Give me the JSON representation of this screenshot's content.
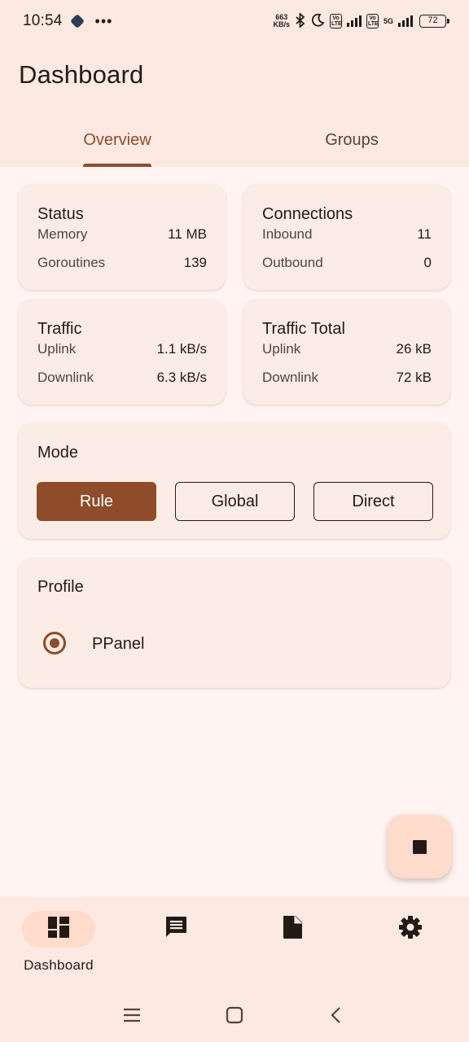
{
  "status_bar": {
    "time": "10:54",
    "more": "•••",
    "net_speed_value": "663",
    "net_speed_unit": "KB/s",
    "volte_1": "Vo LTE",
    "volte_2": "Vo LTE",
    "network": "5G",
    "battery": "72"
  },
  "header": {
    "title": "Dashboard"
  },
  "tabs": [
    {
      "label": "Overview",
      "active": true
    },
    {
      "label": "Groups",
      "active": false
    }
  ],
  "cards": {
    "status": {
      "title": "Status",
      "rows": [
        {
          "key": "Memory",
          "value": "11 MB"
        },
        {
          "key": "Goroutines",
          "value": "139"
        }
      ]
    },
    "connections": {
      "title": "Connections",
      "rows": [
        {
          "key": "Inbound",
          "value": "11"
        },
        {
          "key": "Outbound",
          "value": "0"
        }
      ]
    },
    "traffic": {
      "title": "Traffic",
      "rows": [
        {
          "key": "Uplink",
          "value": "1.1 kB/s"
        },
        {
          "key": "Downlink",
          "value": "6.3 kB/s"
        }
      ]
    },
    "traffic_total": {
      "title": "Traffic Total",
      "rows": [
        {
          "key": "Uplink",
          "value": "26 kB"
        },
        {
          "key": "Downlink",
          "value": "72 kB"
        }
      ]
    }
  },
  "mode": {
    "title": "Mode",
    "options": [
      "Rule",
      "Global",
      "Direct"
    ],
    "selected": "Rule"
  },
  "profile": {
    "title": "Profile",
    "items": [
      {
        "label": "PPanel",
        "selected": true
      }
    ]
  },
  "fab": {
    "icon": "stop-icon"
  },
  "bottom_nav": {
    "items": [
      {
        "icon": "dashboard-icon",
        "label": "Dashboard",
        "active": true
      },
      {
        "icon": "message-icon",
        "label": "",
        "active": false
      },
      {
        "icon": "document-icon",
        "label": "",
        "active": false
      },
      {
        "icon": "settings-icon",
        "label": "",
        "active": false
      }
    ]
  },
  "colors": {
    "accent": "#8F4C2A",
    "surface": "#FFF4F1",
    "card": "#FCECE6",
    "fab": "#FFDBCB"
  }
}
